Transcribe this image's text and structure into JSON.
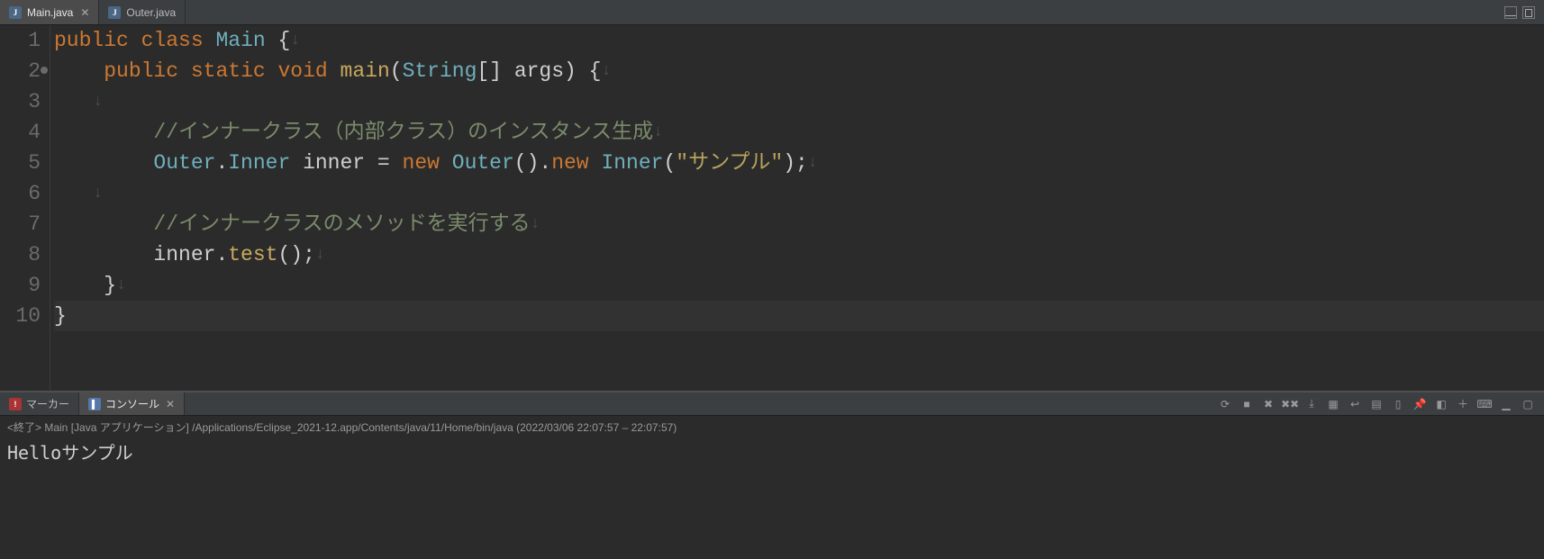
{
  "editor": {
    "tabs": [
      {
        "label": "Main.java",
        "active": true
      },
      {
        "label": "Outer.java",
        "active": false
      }
    ]
  },
  "code": {
    "lines": [
      {
        "num": "1",
        "tokens": [
          [
            "kw",
            "public"
          ],
          [
            "pln",
            " "
          ],
          [
            "kw",
            "class"
          ],
          [
            "pln",
            " "
          ],
          [
            "cls",
            "Main"
          ],
          [
            "pln",
            " "
          ],
          [
            "punc",
            "{"
          ]
        ]
      },
      {
        "num": "2",
        "marker": true,
        "tokens": [
          [
            "pln",
            "    "
          ],
          [
            "kw",
            "public"
          ],
          [
            "pln",
            " "
          ],
          [
            "kw",
            "static"
          ],
          [
            "pln",
            " "
          ],
          [
            "kw",
            "void"
          ],
          [
            "pln",
            " "
          ],
          [
            "mth",
            "main"
          ],
          [
            "punc",
            "("
          ],
          [
            "cls",
            "String"
          ],
          [
            "punc",
            "[]"
          ],
          [
            "pln",
            " "
          ],
          [
            "pln",
            "args"
          ],
          [
            "punc",
            ")"
          ],
          [
            "pln",
            " "
          ],
          [
            "punc",
            "{"
          ]
        ]
      },
      {
        "num": "3",
        "tokens": []
      },
      {
        "num": "4",
        "tokens": [
          [
            "pln",
            "        "
          ],
          [
            "cmt",
            "//インナークラス（内部クラス）のインスタンス生成"
          ]
        ]
      },
      {
        "num": "5",
        "tokens": [
          [
            "pln",
            "        "
          ],
          [
            "cls",
            "Outer"
          ],
          [
            "punc",
            "."
          ],
          [
            "cls",
            "Inner"
          ],
          [
            "pln",
            " "
          ],
          [
            "pln",
            "inner"
          ],
          [
            "pln",
            " "
          ],
          [
            "punc",
            "="
          ],
          [
            "pln",
            " "
          ],
          [
            "kw",
            "new"
          ],
          [
            "pln",
            " "
          ],
          [
            "cls",
            "Outer"
          ],
          [
            "punc",
            "()."
          ],
          [
            "kw",
            "new"
          ],
          [
            "pln",
            " "
          ],
          [
            "cls",
            "Inner"
          ],
          [
            "punc",
            "("
          ],
          [
            "str",
            "\"サンプル\""
          ],
          [
            "punc",
            ");"
          ]
        ]
      },
      {
        "num": "6",
        "tokens": []
      },
      {
        "num": "7",
        "tokens": [
          [
            "pln",
            "        "
          ],
          [
            "cmt",
            "//インナークラスのメソッドを実行する"
          ]
        ]
      },
      {
        "num": "8",
        "tokens": [
          [
            "pln",
            "        "
          ],
          [
            "pln",
            "inner"
          ],
          [
            "punc",
            "."
          ],
          [
            "mth",
            "test"
          ],
          [
            "punc",
            "();"
          ]
        ]
      },
      {
        "num": "9",
        "tokens": [
          [
            "pln",
            "    "
          ],
          [
            "punc",
            "}"
          ]
        ]
      },
      {
        "num": "10",
        "current": true,
        "tokens": [
          [
            "punc",
            "}"
          ]
        ]
      }
    ],
    "whitespace_glyph": "↓"
  },
  "bottom_panel": {
    "tabs": [
      {
        "label": "マーカー",
        "icon": "markers",
        "active": false
      },
      {
        "label": "コンソール",
        "icon": "console",
        "active": true
      }
    ],
    "status": "<終了> Main [Java アプリケーション] /Applications/Eclipse_2021-12.app/Contents/java/11/Home/bin/java  (2022/03/06 22:07:57 – 22:07:57)",
    "output": "Helloサンプル",
    "toolbar": [
      "refresh-icon",
      "stop-icon",
      "remove-icon",
      "remove-all-icon",
      "scroll-lock-icon",
      "show-console-icon",
      "word-wrap-icon",
      "open-console-icon",
      "clear-console-icon",
      "pin-icon",
      "display-selected-icon",
      "new-console-icon",
      "terminal-icon",
      "minimize-view-icon",
      "maximize-view-icon"
    ]
  }
}
